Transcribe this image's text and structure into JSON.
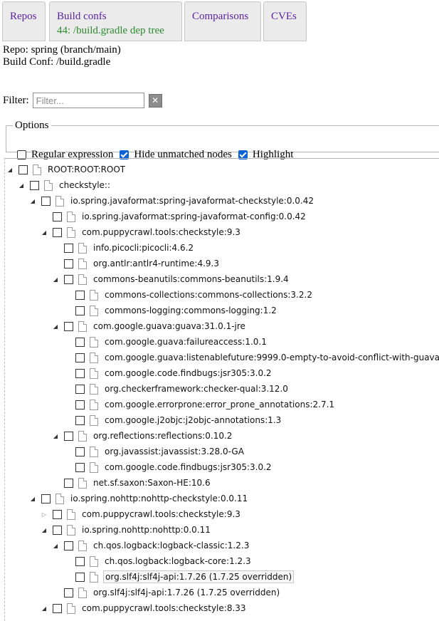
{
  "tabs": [
    {
      "label": "Repos",
      "sub": ""
    },
    {
      "label": "Build confs",
      "sub": "44: /build.gradle dep tree"
    },
    {
      "label": "Comparisons",
      "sub": ""
    },
    {
      "label": "CVEs",
      "sub": ""
    }
  ],
  "info": {
    "repo": "Repo: spring (branch/main)",
    "build_conf": "Build Conf: /build.gradle"
  },
  "filter": {
    "label": "Filter:",
    "placeholder": "Filter...",
    "value": "",
    "clear_glyph": "✕"
  },
  "options": {
    "legend": "Options",
    "items": [
      {
        "label": "Regular expression",
        "checked": false
      },
      {
        "label": "Hide unmatched nodes",
        "checked": true
      },
      {
        "label": "Highlight",
        "checked": true
      }
    ]
  },
  "tree": [
    {
      "depth": 0,
      "toggle": "open",
      "label": "ROOT:ROOT:ROOT"
    },
    {
      "depth": 1,
      "toggle": "open",
      "label": "checkstyle::"
    },
    {
      "depth": 2,
      "toggle": "open",
      "label": "io.spring.javaformat:spring-javaformat-checkstyle:0.0.42"
    },
    {
      "depth": 3,
      "toggle": "none",
      "label": "io.spring.javaformat:spring-javaformat-config:0.0.42"
    },
    {
      "depth": 3,
      "toggle": "open",
      "label": "com.puppycrawl.tools:checkstyle:9.3"
    },
    {
      "depth": 4,
      "toggle": "none",
      "label": "info.picocli:picocli:4.6.2"
    },
    {
      "depth": 4,
      "toggle": "none",
      "label": "org.antlr:antlr4-runtime:4.9.3"
    },
    {
      "depth": 4,
      "toggle": "open",
      "label": "commons-beanutils:commons-beanutils:1.9.4"
    },
    {
      "depth": 5,
      "toggle": "none",
      "label": "commons-collections:commons-collections:3.2.2"
    },
    {
      "depth": 5,
      "toggle": "none",
      "label": "commons-logging:commons-logging:1.2"
    },
    {
      "depth": 4,
      "toggle": "open",
      "label": "com.google.guava:guava:31.0.1-jre"
    },
    {
      "depth": 5,
      "toggle": "none",
      "label": "com.google.guava:failureaccess:1.0.1"
    },
    {
      "depth": 5,
      "toggle": "none",
      "label": "com.google.guava:listenablefuture:9999.0-empty-to-avoid-conflict-with-guava"
    },
    {
      "depth": 5,
      "toggle": "none",
      "label": "com.google.code.findbugs:jsr305:3.0.2"
    },
    {
      "depth": 5,
      "toggle": "none",
      "label": "org.checkerframework:checker-qual:3.12.0"
    },
    {
      "depth": 5,
      "toggle": "none",
      "label": "com.google.errorprone:error_prone_annotations:2.7.1"
    },
    {
      "depth": 5,
      "toggle": "none",
      "label": "com.google.j2objc:j2objc-annotations:1.3"
    },
    {
      "depth": 4,
      "toggle": "open",
      "label": "org.reflections:reflections:0.10.2"
    },
    {
      "depth": 5,
      "toggle": "none",
      "label": "org.javassist:javassist:3.28.0-GA"
    },
    {
      "depth": 5,
      "toggle": "none",
      "label": "com.google.code.findbugs:jsr305:3.0.2"
    },
    {
      "depth": 4,
      "toggle": "none",
      "label": "net.sf.saxon:Saxon-HE:10.6"
    },
    {
      "depth": 2,
      "toggle": "open",
      "label": "io.spring.nohttp:nohttp-checkstyle:0.0.11"
    },
    {
      "depth": 3,
      "toggle": "closed",
      "label": "com.puppycrawl.tools:checkstyle:9.3"
    },
    {
      "depth": 3,
      "toggle": "open",
      "label": "io.spring.nohttp:nohttp:0.0.11"
    },
    {
      "depth": 4,
      "toggle": "open",
      "label": "ch.qos.logback:logback-classic:1.2.3"
    },
    {
      "depth": 5,
      "toggle": "none",
      "label": "ch.qos.logback:logback-core:1.2.3"
    },
    {
      "depth": 5,
      "toggle": "none",
      "label": "org.slf4j:slf4j-api:1.7.26 (1.7.25 overridden)",
      "highlight": true
    },
    {
      "depth": 4,
      "toggle": "none",
      "label": "org.slf4j:slf4j-api:1.7.26 (1.7.25 overridden)"
    },
    {
      "depth": 3,
      "toggle": "open",
      "label": "com.puppycrawl.tools:checkstyle:8.33"
    }
  ]
}
